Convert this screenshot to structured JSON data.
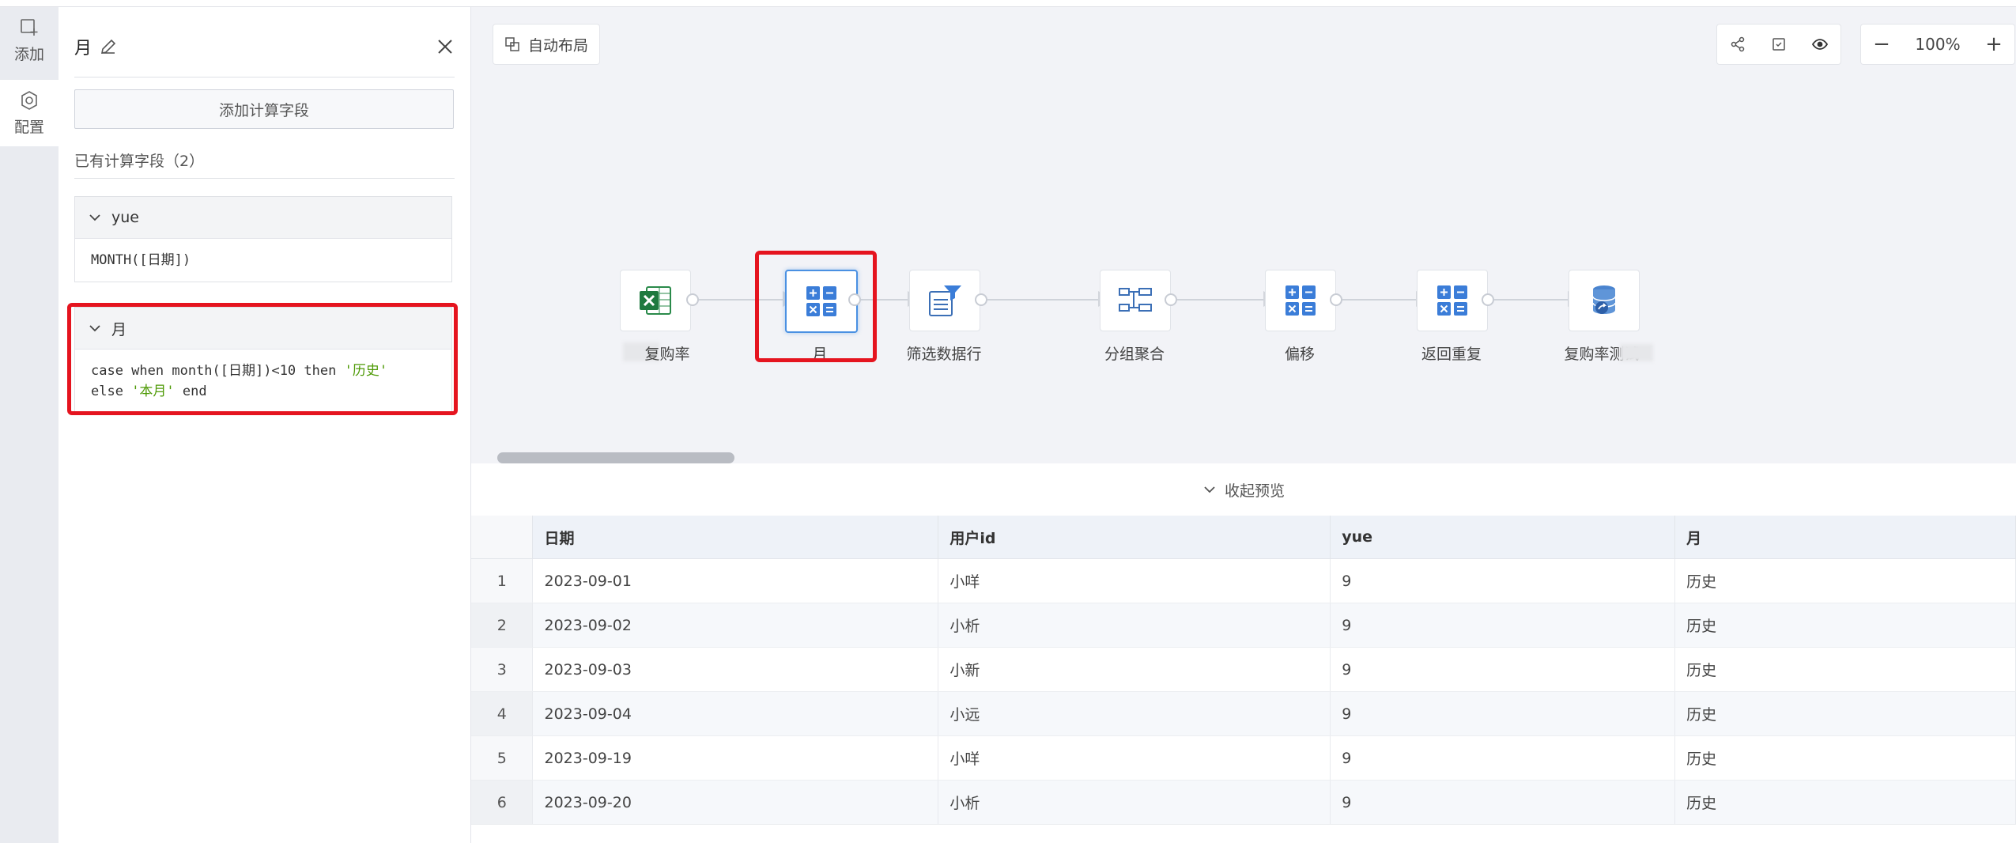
{
  "rail": {
    "add_label": "添加",
    "config_label": "配置"
  },
  "panel": {
    "title": "月",
    "add_field_button": "添加计算字段",
    "existing_label": "已有计算字段（2）",
    "fields": [
      {
        "name": "yue",
        "formula": "MONTH([日期])"
      },
      {
        "name": "月",
        "formula_part1": "case when month([日期])<10 then ",
        "str1": "'历史'",
        "formula_part2": "else ",
        "str2": "'本月'",
        "formula_part3": " end"
      }
    ]
  },
  "toolbar": {
    "auto_layout": "自动布局",
    "zoom": "100%",
    "zoom_out": "−",
    "zoom_in": "+"
  },
  "flow": {
    "nodes": [
      {
        "label": "复购率",
        "icon": "excel-icon"
      },
      {
        "label": "月",
        "icon": "calculator-icon"
      },
      {
        "label": "筛选数据行",
        "icon": "filter-icon"
      },
      {
        "label": "分组聚合",
        "icon": "group-icon"
      },
      {
        "label": "偏移",
        "icon": "calculator-icon"
      },
      {
        "label": "返回重复",
        "icon": "calculator-icon"
      },
      {
        "label": "复购率测试",
        "icon": "database-icon"
      }
    ]
  },
  "preview": {
    "collapse_label": "收起预览",
    "columns": [
      "日期",
      "用户id",
      "yue",
      "月"
    ],
    "rows": [
      {
        "idx": "1",
        "date": "2023-09-01",
        "user": "小咩",
        "yue": "9",
        "month": "历史"
      },
      {
        "idx": "2",
        "date": "2023-09-02",
        "user": "小析",
        "yue": "9",
        "month": "历史"
      },
      {
        "idx": "3",
        "date": "2023-09-03",
        "user": "小新",
        "yue": "9",
        "month": "历史"
      },
      {
        "idx": "4",
        "date": "2023-09-04",
        "user": "小远",
        "yue": "9",
        "month": "历史"
      },
      {
        "idx": "5",
        "date": "2023-09-19",
        "user": "小咩",
        "yue": "9",
        "month": "历史"
      },
      {
        "idx": "6",
        "date": "2023-09-20",
        "user": "小析",
        "yue": "9",
        "month": "历史"
      }
    ]
  },
  "colors": {
    "accent": "#4a90e2",
    "highlight": "#e5141f",
    "excel": "#1f7a3f"
  }
}
